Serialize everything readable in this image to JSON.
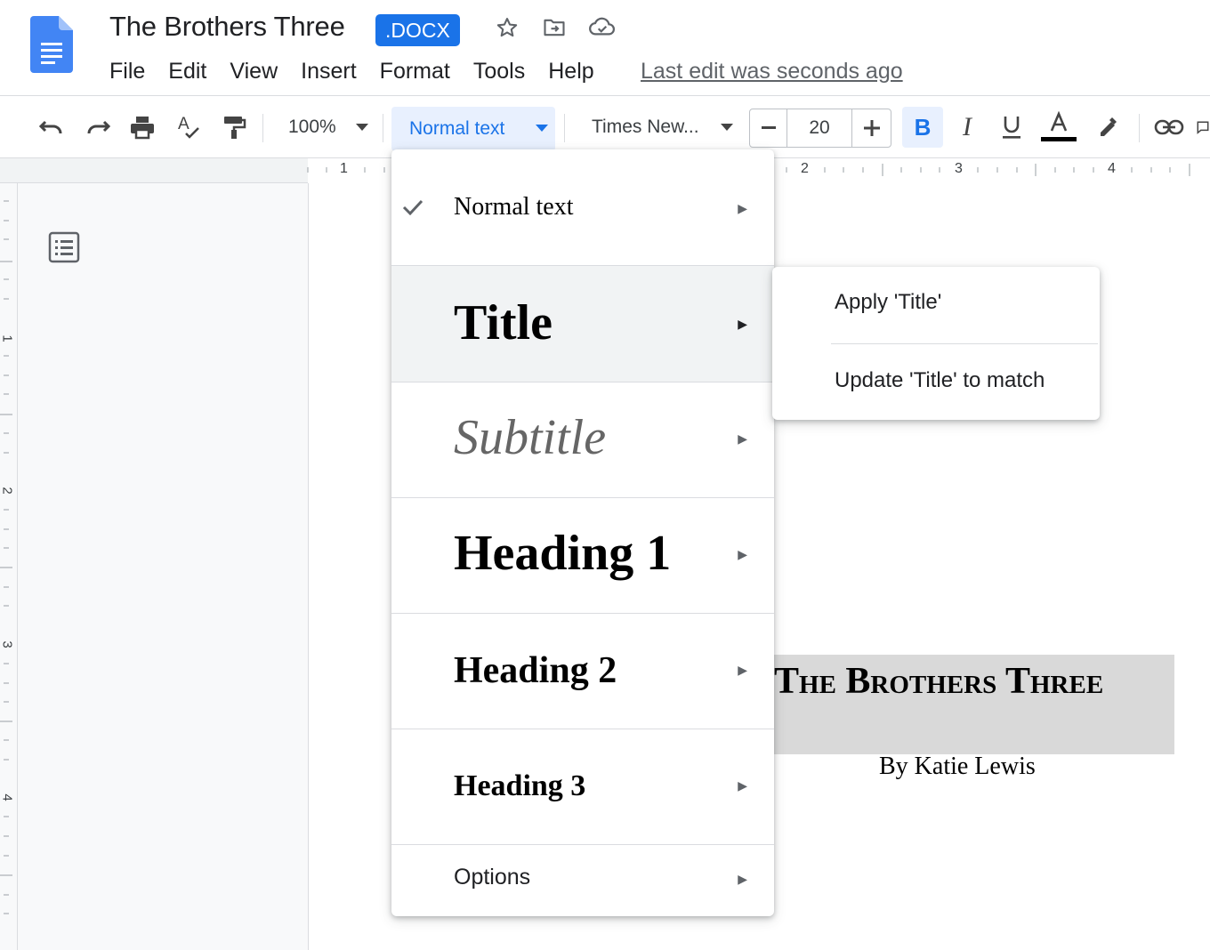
{
  "app": {
    "doc_title": "The Brothers Three",
    "file_badge": ".DOCX",
    "last_edit": "Last edit was seconds ago",
    "brand_color": "#1a73e8"
  },
  "menubar": {
    "items": [
      "File",
      "Edit",
      "View",
      "Insert",
      "Format",
      "Tools",
      "Help"
    ]
  },
  "title_icons": [
    "star-icon",
    "move-to-folder-icon",
    "cloud-saved-icon"
  ],
  "toolbar": {
    "zoom": "100%",
    "style": "Normal text",
    "font": "Times New...",
    "font_size": "20",
    "icons": [
      "undo-icon",
      "redo-icon",
      "print-icon",
      "spellcheck-icon",
      "paint-format-icon",
      "bold-icon",
      "italic-icon",
      "underline-icon",
      "text-color-icon",
      "highlight-icon",
      "link-icon",
      "comment-icon"
    ]
  },
  "ruler": {
    "horizontal": [
      "1",
      "2",
      "3",
      "4"
    ],
    "vertical": [
      "1",
      "2",
      "3",
      "4"
    ]
  },
  "style_menu": {
    "items": [
      {
        "label": "Normal text",
        "checked": true
      },
      {
        "label": "Title",
        "checked": false,
        "highlighted": true
      },
      {
        "label": "Subtitle",
        "checked": false
      },
      {
        "label": "Heading 1",
        "checked": false
      },
      {
        "label": "Heading 2",
        "checked": false
      },
      {
        "label": "Heading 3",
        "checked": false
      },
      {
        "label": "Options",
        "checked": false
      }
    ]
  },
  "submenu": {
    "items": [
      "Apply 'Title'",
      "Update 'Title' to match"
    ]
  },
  "document": {
    "heading": "The Brothers Three",
    "byline": "By Katie Lewis"
  }
}
